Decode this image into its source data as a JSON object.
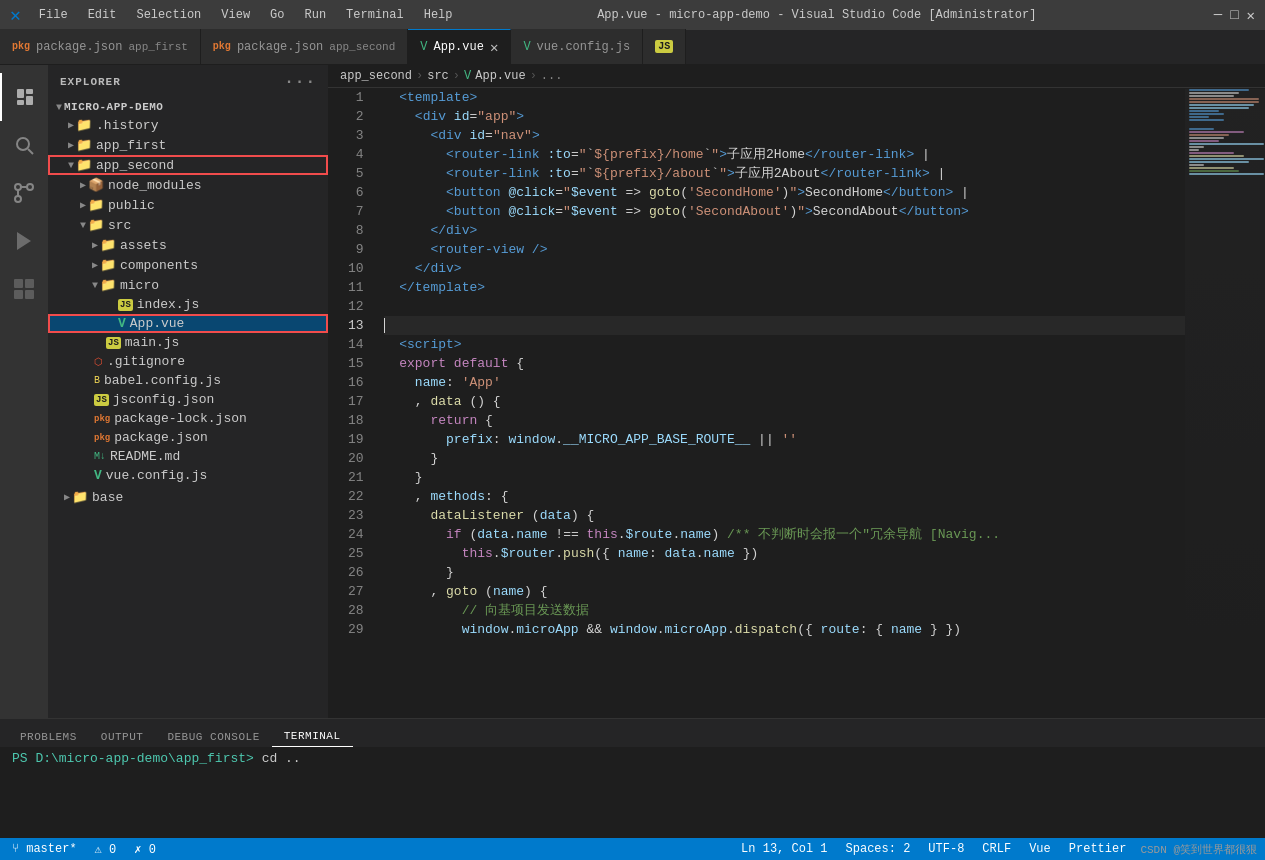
{
  "titleBar": {
    "icon": "⎈",
    "menus": [
      "File",
      "Edit",
      "Selection",
      "View",
      "Go",
      "Run",
      "Terminal",
      "Help"
    ],
    "title": "App.vue - micro-app-demo - Visual Studio Code [Administrator]"
  },
  "tabs": [
    {
      "id": "tab-pkg-first",
      "icon": "pkg",
      "label": "package.json",
      "sublabel": "app_first",
      "active": false,
      "modified": false
    },
    {
      "id": "tab-pkg-second",
      "icon": "pkg",
      "label": "package.json",
      "sublabel": "app_second",
      "active": false,
      "modified": false
    },
    {
      "id": "tab-appvue",
      "icon": "vue",
      "label": "App.vue",
      "active": true,
      "modified": false,
      "close": true
    },
    {
      "id": "tab-vueconfig",
      "icon": "vue",
      "label": "vue.config.js",
      "active": false,
      "modified": false
    },
    {
      "id": "tab-js",
      "icon": "js",
      "label": "JS",
      "active": false
    }
  ],
  "sidebar": {
    "title": "EXPLORER",
    "root": "MICRO-APP-DEMO",
    "items": [
      {
        "id": "history",
        "label": ".history",
        "type": "folder",
        "indent": 1,
        "collapsed": true,
        "icon": "📁"
      },
      {
        "id": "app_first",
        "label": "app_first",
        "type": "folder",
        "indent": 1,
        "collapsed": true,
        "icon": "📁"
      },
      {
        "id": "app_second",
        "label": "app_second",
        "type": "folder",
        "indent": 1,
        "collapsed": false,
        "icon": "📁",
        "highlighted": true
      },
      {
        "id": "node_modules",
        "label": "node_modules",
        "type": "folder",
        "indent": 2,
        "collapsed": true,
        "icon": "📦"
      },
      {
        "id": "public",
        "label": "public",
        "type": "folder",
        "indent": 2,
        "collapsed": true,
        "icon": "📁"
      },
      {
        "id": "src",
        "label": "src",
        "type": "folder",
        "indent": 2,
        "collapsed": false,
        "icon": "📁"
      },
      {
        "id": "assets",
        "label": "assets",
        "type": "folder",
        "indent": 3,
        "collapsed": true,
        "icon": "📁"
      },
      {
        "id": "components",
        "label": "components",
        "type": "folder",
        "indent": 3,
        "collapsed": true,
        "icon": "📁"
      },
      {
        "id": "micro",
        "label": "micro",
        "type": "folder",
        "indent": 3,
        "collapsed": false,
        "icon": "📁"
      },
      {
        "id": "index_js",
        "label": "index.js",
        "type": "js",
        "indent": 4
      },
      {
        "id": "app_vue",
        "label": "App.vue",
        "type": "vue",
        "indent": 4,
        "highlighted": true,
        "selected": true
      },
      {
        "id": "main_js",
        "label": "main.js",
        "type": "js",
        "indent": 3
      },
      {
        "id": "gitignore",
        "label": ".gitignore",
        "type": "git",
        "indent": 2
      },
      {
        "id": "babel_config",
        "label": "babel.config.js",
        "type": "babel",
        "indent": 2
      },
      {
        "id": "jsconfig_json",
        "label": "jsconfig.json",
        "type": "json",
        "indent": 2
      },
      {
        "id": "pkg_lock",
        "label": "package-lock.json",
        "type": "pkg",
        "indent": 2
      },
      {
        "id": "pkg_json",
        "label": "package.json",
        "type": "pkg",
        "indent": 2
      },
      {
        "id": "readme",
        "label": "README.md",
        "type": "md",
        "indent": 2
      },
      {
        "id": "vue_config",
        "label": "vue.config.js",
        "type": "vue",
        "indent": 2
      },
      {
        "id": "base",
        "label": "base",
        "type": "folder",
        "indent": 1,
        "collapsed": true,
        "icon": "📁"
      }
    ]
  },
  "breadcrumb": {
    "parts": [
      "app_second",
      "src",
      "App.vue",
      "..."
    ]
  },
  "code": {
    "lines": [
      {
        "num": 1,
        "content": "  <template>"
      },
      {
        "num": 2,
        "content": "    <div id=\"app\">"
      },
      {
        "num": 3,
        "content": "      <div id=\"nav\">"
      },
      {
        "num": 4,
        "content": "        <router-link :to=\"`${prefix}/home`\">子应用2Home</router-link> |"
      },
      {
        "num": 5,
        "content": "        <router-link :to=\"`${prefix}/about`\">子应用2About</router-link> |"
      },
      {
        "num": 6,
        "content": "        <button @click=\"$event => goto('SecondHome')\">SecondHome</button> |"
      },
      {
        "num": 7,
        "content": "        <button @click=\"$event => goto('SecondAbout')\">SecondAbout</button>"
      },
      {
        "num": 8,
        "content": "      </div>"
      },
      {
        "num": 9,
        "content": "      <router-view />"
      },
      {
        "num": 10,
        "content": "    </div>"
      },
      {
        "num": 11,
        "content": "  </template>"
      },
      {
        "num": 12,
        "content": ""
      },
      {
        "num": 13,
        "content": ""
      },
      {
        "num": 14,
        "content": "  <script>"
      },
      {
        "num": 15,
        "content": "  export default {"
      },
      {
        "num": 16,
        "content": "    name: 'App'"
      },
      {
        "num": 17,
        "content": "    , data () {"
      },
      {
        "num": 18,
        "content": "      return {"
      },
      {
        "num": 19,
        "content": "        prefix: window.__MICRO_APP_BASE_ROUTE__ || ''"
      },
      {
        "num": 20,
        "content": "      }"
      },
      {
        "num": 21,
        "content": "    }"
      },
      {
        "num": 22,
        "content": "    , methods: {"
      },
      {
        "num": 23,
        "content": "      dataListener (data) {"
      },
      {
        "num": 24,
        "content": "        if (data.name !== this.$route.name) /** 不判断时会报一个\"冗余导航 [Navig..."
      },
      {
        "num": 25,
        "content": "          this.$router.push({ name: data.name })"
      },
      {
        "num": 26,
        "content": "        }"
      },
      {
        "num": 27,
        "content": "      , goto (name) {"
      },
      {
        "num": 28,
        "content": "          // 向基项目发送数据"
      },
      {
        "num": 29,
        "content": "          window.microApp && window.microApp.dispatch({ route: { name } })"
      }
    ]
  },
  "bottomPanel": {
    "tabs": [
      "PROBLEMS",
      "OUTPUT",
      "DEBUG CONSOLE",
      "TERMINAL"
    ],
    "activeTab": "TERMINAL",
    "terminalText": "PS D:\\micro-app-demo\\app_first> cd .."
  },
  "statusBar": {
    "left": [
      "⑂ master*",
      "⚠ 0",
      "✗ 0"
    ],
    "right": [
      "Ln 13, Col 1",
      "Spaces: 2",
      "UTF-8",
      "CRLF",
      "Vue",
      "Prettier"
    ]
  },
  "watermark": "CSDN @笑到世界都很狠"
}
